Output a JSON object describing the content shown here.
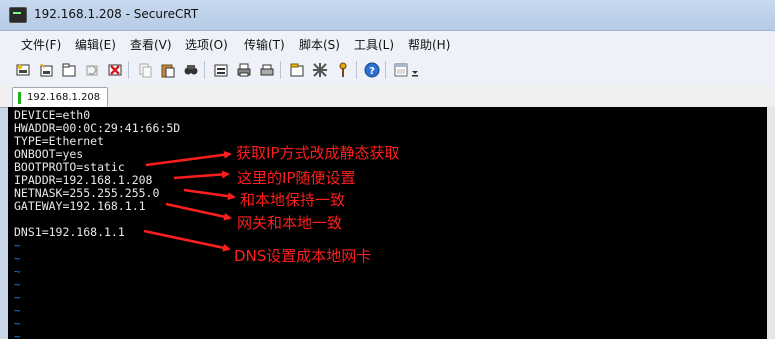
{
  "window": {
    "title": "192.168.1.208 - SecureCRT"
  },
  "menu": [
    "文件(F)",
    "编辑(E)",
    "查看(V)",
    "选项(O)",
    "传输(T)",
    "脚本(S)",
    "工具(L)",
    "帮助(H)"
  ],
  "toolbar_icons": [
    "connect-icon",
    "quick-connect-icon",
    "connect-tab-icon",
    "reconnect-icon",
    "disconnect-icon",
    "copy-icon",
    "paste-icon",
    "find-icon",
    "print-setup-icon",
    "print-icon",
    "print-selection-icon",
    "session-options-icon",
    "global-options-icon",
    "keymap-icon",
    "help-icon",
    "window-icon",
    "toolbar-overflow-icon"
  ],
  "tab": {
    "label": "192.168.1.208"
  },
  "terminal": {
    "lines": [
      "DEVICE=eth0",
      "HWADDR=00:0C:29:41:66:5D",
      "TYPE=Ethernet",
      "ONBOOT=yes",
      "BOOTPROTO=static",
      "IPADDR=192.168.1.208",
      "NETNASK=255.255.255.0",
      "GATEWAY=192.168.1.1",
      "",
      "DNS1=192.168.1.1"
    ],
    "tilde": "~"
  },
  "annotations": [
    "获取IP方式改成静态获取",
    "这里的IP随便设置",
    "和本地保持一致",
    "网关和本地一致",
    "DNS设置成本地网卡"
  ],
  "colors": {
    "annotation": "#ff1e1e",
    "terminal_bg": "#000000",
    "tilde": "#1e7fff"
  }
}
